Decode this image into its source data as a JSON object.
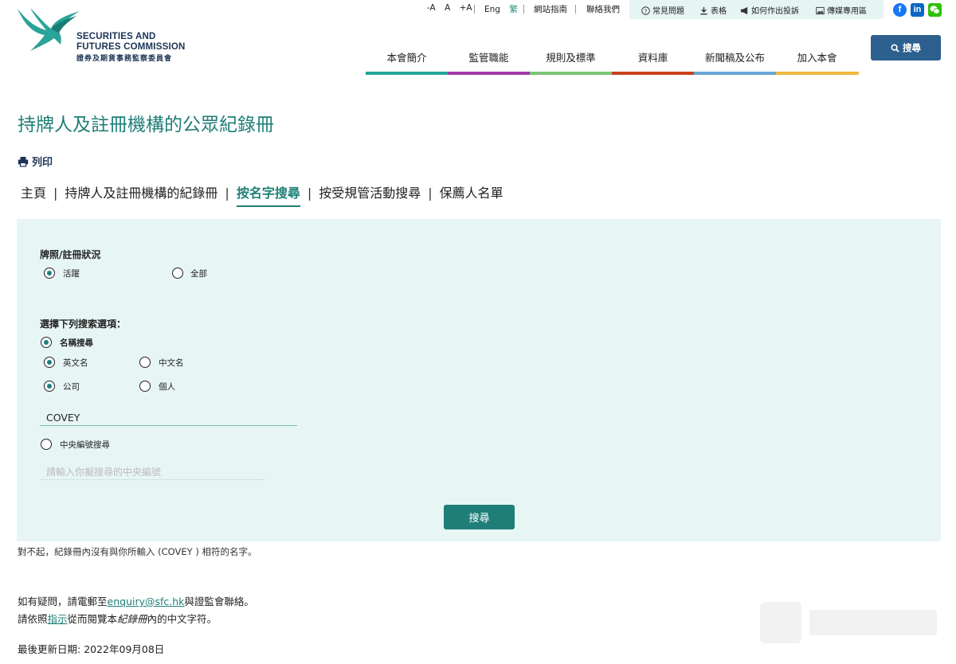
{
  "header": {
    "logo": {
      "line1": "SECURITIES AND",
      "line2": "FUTURES COMMISSION",
      "line3": "證券及期貨事務監察委員會"
    },
    "font_controls": [
      "-A",
      "A",
      "+A"
    ],
    "languages": {
      "english": "Eng",
      "traditional": "繁"
    },
    "sitemap": "網站指南",
    "contact_us": "聯絡我們",
    "utility": {
      "faq": "常見問題",
      "forms": "表格",
      "complaints": "如何作出投訴",
      "media": "傳媒專用區"
    },
    "social_icons": [
      "facebook-icon",
      "linkedin-icon",
      "wechat-icon"
    ],
    "search_label": "搜尋",
    "nav": [
      {
        "label": "本會簡介",
        "color": "#23a69a"
      },
      {
        "label": "監管職能",
        "color": "#a33aa8"
      },
      {
        "label": "規則及標準",
        "color": "#7cc576"
      },
      {
        "label": "資料庫",
        "color": "#c9401c"
      },
      {
        "label": "新聞稿及公布",
        "color": "#6aa6d6"
      },
      {
        "label": "加入本會",
        "color": "#f0b740"
      }
    ]
  },
  "page": {
    "title": "持牌人及註冊機構的公眾紀錄冊",
    "print_label": "列印",
    "breadcrumbs": [
      "主頁",
      "持牌人及註冊機構的紀錄冊",
      "按名字搜尋",
      "按受規管活動搜尋",
      "保薦人名單"
    ],
    "active_crumb": 2
  },
  "form": {
    "status_label": "牌照/註冊狀況",
    "status_options": [
      {
        "label": "活躍",
        "selected": true
      },
      {
        "label": "全部",
        "selected": false
      }
    ],
    "search_options_label": "選擇下列搜索選項：",
    "name_search": {
      "label": "名稱搜尋",
      "selected": true
    },
    "name_language": [
      {
        "label": "英文名",
        "selected": true
      },
      {
        "label": "中文名",
        "selected": false
      }
    ],
    "entity_type": [
      {
        "label": "公司",
        "selected": true
      },
      {
        "label": "個人",
        "selected": false
      }
    ],
    "name_value": "COVEY",
    "ce_search": {
      "label": "中央編號搜尋",
      "selected": false
    },
    "ce_placeholder": "請輸入你擬搜尋的中央編號",
    "submit_label": "搜尋"
  },
  "result": {
    "message": "對不起，紀錄冊內沒有與你所輸入 (COVEY ) 相符的名字。"
  },
  "footer": {
    "contact_prefix": "如有疑問，請電郵至",
    "email": "enquiry@sfc.hk",
    "contact_suffix": "與證監會聯絡。",
    "guide_prefix": "請依照",
    "guide_link": "指示",
    "guide_middle": "從而閱覽本",
    "guide_italic": "紀錄冊",
    "guide_suffix": "內的中文字符。",
    "updated_label": "最後更新日期: ",
    "updated_date": "2022年09月08日"
  },
  "colors": {
    "brand_teal": "#1f7f78",
    "navy": "#1c3355",
    "panel_bg": "#e7f6f5",
    "search_blue": "#2d5f8f"
  }
}
